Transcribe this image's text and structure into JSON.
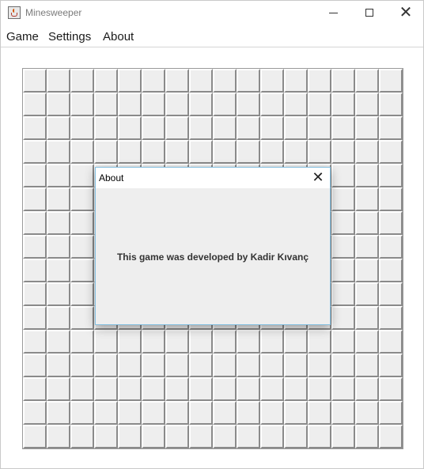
{
  "window": {
    "title": "Minesweeper",
    "controls": {
      "minimize_icon": "minimize-icon",
      "maximize_icon": "maximize-icon",
      "close_icon": "close-icon",
      "close_glyph": "✕"
    }
  },
  "menu": {
    "items": [
      "Game",
      "Settings",
      "About"
    ]
  },
  "board": {
    "rows": 16,
    "cols": 16,
    "cell_state": "unrevealed"
  },
  "dialog": {
    "title": "About",
    "close_glyph": "✕",
    "message": "This game was developed by Kadir Kıvanç"
  },
  "colors": {
    "cell_face": "#eeeeee",
    "dialog_border": "#84bfe0",
    "dialog_bg": "#eeeeee"
  }
}
